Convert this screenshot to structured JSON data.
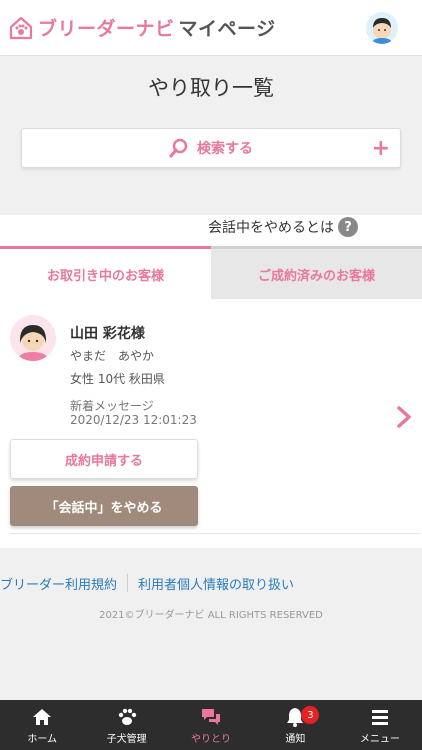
{
  "header": {
    "logo_text": "ブリーダーナビ",
    "logo_sub": "マイページ"
  },
  "page": {
    "title": "やり取り一覧"
  },
  "search": {
    "label": "検索する",
    "plus": "+"
  },
  "quit_info": {
    "text": "会話中をやめるとは",
    "help": "?"
  },
  "tabs": [
    {
      "label": "お取引き中のお客様",
      "active": true
    },
    {
      "label": "ご成約済みのお客様",
      "active": false
    }
  ],
  "customer": {
    "name": "山田 彩花様",
    "kana": "やまだ　あやか",
    "attributes": "女性 10代 秋田県",
    "message_label": "新着メッセージ",
    "message_time": "2020/12/23 12:01:23"
  },
  "buttons": {
    "contract": "成約申請する",
    "quit": "「会話中」をやめる"
  },
  "footer": {
    "links": [
      "ブリーダー利用規約",
      "利用者個人情報の取り扱い"
    ],
    "copyright": "2021©ブリーダーナビ ALL RIGHTS RESERVED"
  },
  "nav": [
    {
      "label": "ホーム",
      "icon": "home-icon"
    },
    {
      "label": "子犬管理",
      "icon": "paw-icon"
    },
    {
      "label": "やりとり",
      "icon": "chat-icon",
      "active": true
    },
    {
      "label": "通知",
      "icon": "bell-icon",
      "badge": "3"
    },
    {
      "label": "メニュー",
      "icon": "menu-icon"
    }
  ],
  "colors": {
    "accent": "#e9789a",
    "quit_button": "#a08a7c",
    "nav_bg": "#2d2d2d",
    "link": "#2a7bbf",
    "badge": "#e32222"
  }
}
